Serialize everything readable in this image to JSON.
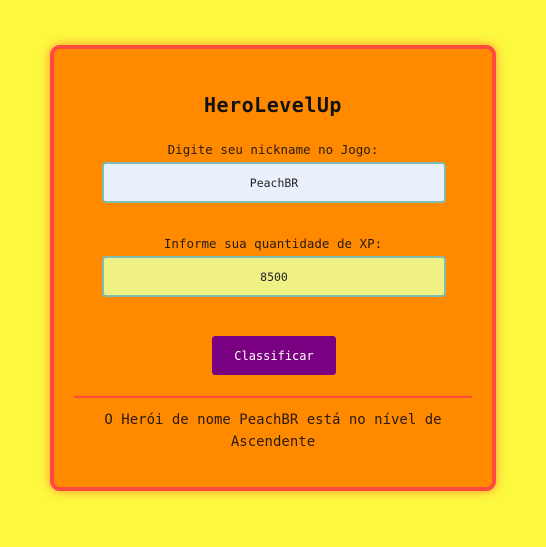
{
  "app": {
    "title": "HeroLevelUp"
  },
  "form": {
    "nickname_label": "Digite seu nickname no Jogo:",
    "nickname_value": "PeachBR",
    "xp_label": "Informe sua quantidade de XP:",
    "xp_value": "8500",
    "submit_label": "Classificar"
  },
  "result": {
    "text": "O Herói de nome PeachBR está no nível de Ascendente"
  },
  "colors": {
    "page_background": "#fdf93f",
    "card_background": "#ff8a00",
    "card_border": "#ff4a3d",
    "nickname_input_bg": "#e9f0fb",
    "xp_input_bg": "#f0f184",
    "button_bg": "#790080"
  }
}
